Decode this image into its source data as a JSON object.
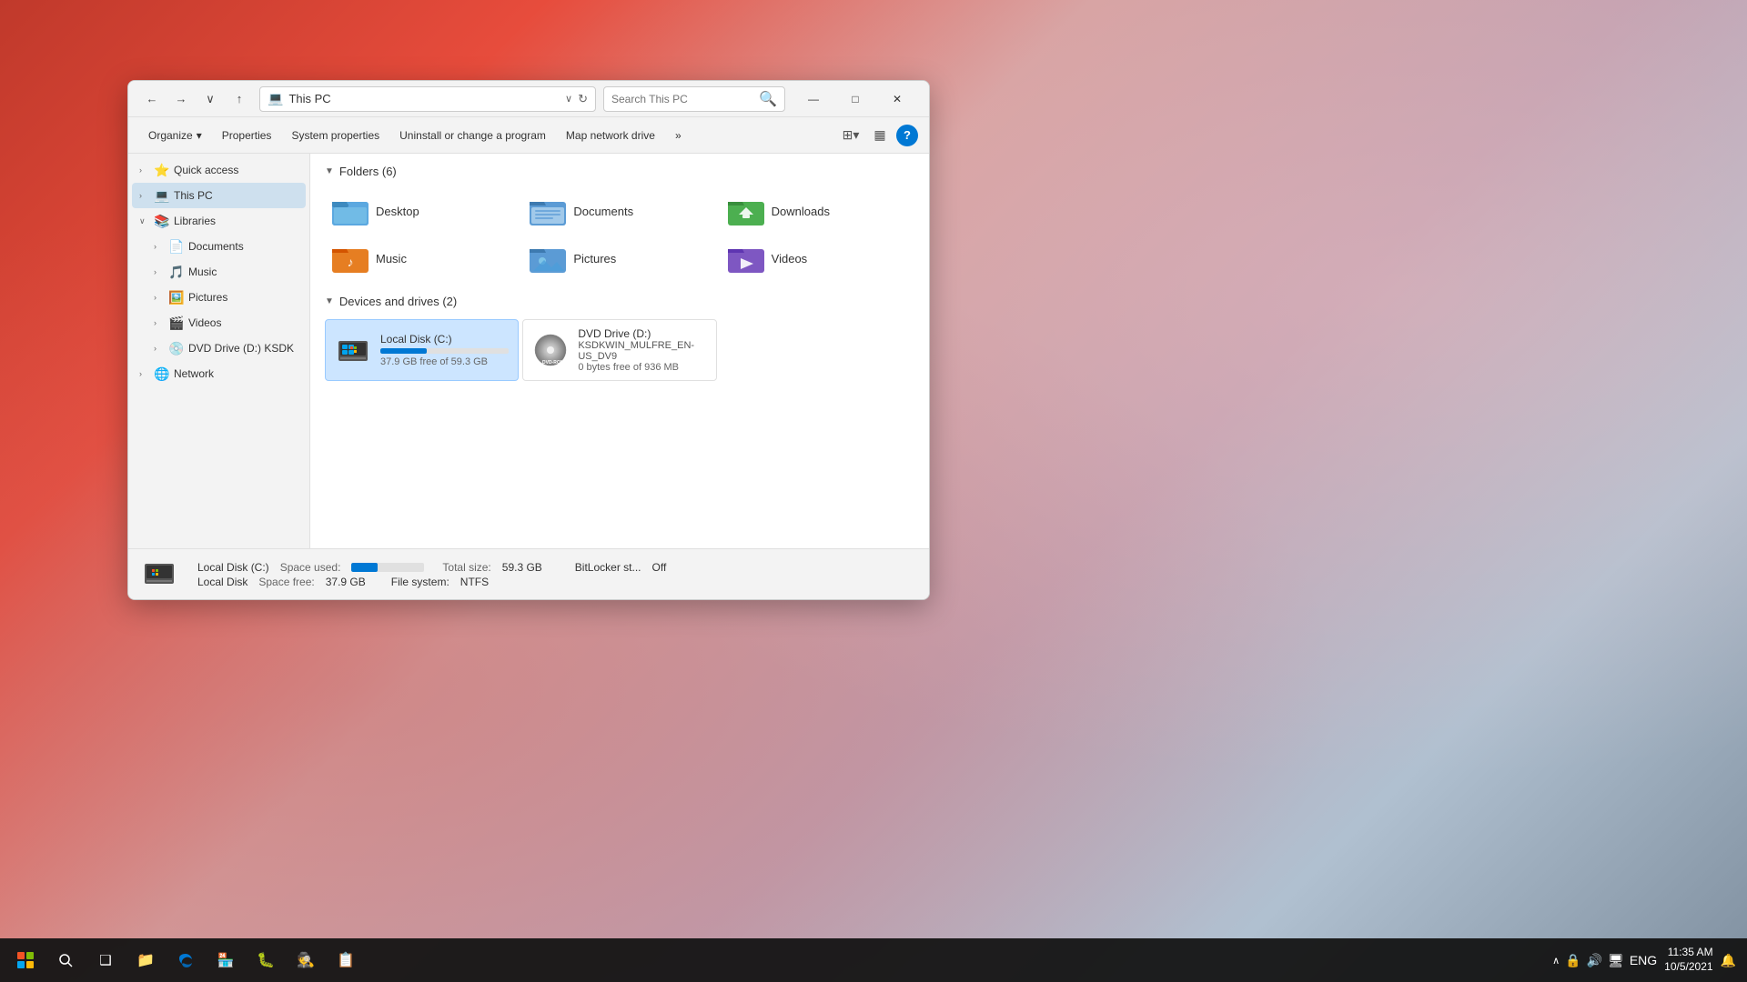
{
  "desktop": {
    "title": "Desktop"
  },
  "window": {
    "title": "This PC",
    "titlebar": {
      "back": "←",
      "forward": "→",
      "dropdown": "∨",
      "up": "↑",
      "address": "This PC",
      "address_icon": "💻",
      "address_dropdown": "∨",
      "refresh": "↻",
      "search_placeholder": "Search This PC",
      "minimize": "—",
      "maximize": "□",
      "close": "✕"
    },
    "toolbar": {
      "organize": "Organize",
      "organize_arrow": "▾",
      "properties": "Properties",
      "system_properties": "System properties",
      "uninstall": "Uninstall or change a program",
      "map_network": "Map network drive",
      "more": "»",
      "view_icon": "⊞",
      "view_arrow": "▾",
      "layout": "▦",
      "help": "?"
    },
    "sidebar": {
      "quick_access": "Quick access",
      "this_pc": "This PC",
      "libraries": "Libraries",
      "documents": "Documents",
      "music": "Music",
      "pictures": "Pictures",
      "videos": "Videos",
      "dvd_drive": "DVD Drive (D:) KSDK",
      "network": "Network"
    },
    "content": {
      "folders_section": "Folders (6)",
      "folders": [
        {
          "name": "Desktop",
          "icon": "🗂️",
          "color": "#4a9eda"
        },
        {
          "name": "Documents",
          "icon": "📄",
          "color": "#5b9bd5"
        },
        {
          "name": "Downloads",
          "icon": "📥",
          "color": "#4caf50"
        },
        {
          "name": "Music",
          "icon": "🎵",
          "color": "#e67e22"
        },
        {
          "name": "Pictures",
          "icon": "🖼️",
          "color": "#5b9bd5"
        },
        {
          "name": "Videos",
          "icon": "🎬",
          "color": "#7e57c2"
        }
      ],
      "drives_section": "Devices and drives (2)",
      "local_disk": {
        "name": "Local Disk (C:)",
        "space_free": "37.9 GB free of 59.3 GB",
        "progress": 36,
        "icon": "💻"
      },
      "dvd_drive": {
        "name": "DVD Drive (D:)",
        "label": "KSDKWIN_MULFRE_EN-US_DV9",
        "space_free": "0 bytes free of 936 MB",
        "icon": "💿"
      }
    },
    "statusbar": {
      "drive_label1": "Local Disk (C:)",
      "drive_label2": "Local Disk",
      "space_used_label": "Space used:",
      "space_free_label": "Space free:",
      "space_free_val": "37.9 GB",
      "total_size_label": "Total size:",
      "total_size_val": "59.3 GB",
      "file_system_label": "File system:",
      "file_system_val": "NTFS",
      "bitlocker_label": "BitLocker st...",
      "bitlocker_val": "Off",
      "progress": 36
    }
  },
  "taskbar": {
    "start_icon": "⊞",
    "search_icon": "🔍",
    "task_view": "❑",
    "file_explorer": "📁",
    "edge": "e",
    "store": "🏪",
    "icons": [
      "🐛",
      "🕵️",
      "📋"
    ],
    "sys_icons": [
      "∧",
      "🔒",
      "🔊",
      "🖥",
      "ENG"
    ],
    "time": "11:35 AM",
    "date": "10/5/2021",
    "notification": "🔔"
  }
}
